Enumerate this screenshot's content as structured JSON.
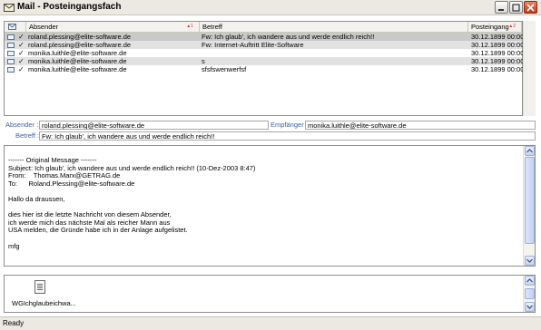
{
  "window": {
    "title": "Mail - Posteingangsfach",
    "accent": "#3b5ea8"
  },
  "list": {
    "columns": {
      "from": "Absender",
      "subject": "Betreff",
      "received": "Posteingang"
    },
    "rows": [
      {
        "from": "roland.plessing@elite-software.de",
        "subject": "Fw: Ich glaub', ich wandere aus und werde endlich reich!!",
        "date": "30.12.1899 00:00",
        "attachment": true,
        "selected": true
      },
      {
        "from": "roland.plessing@elite-software.de",
        "subject": "Fw: Internet-Auftritt Elite-Software",
        "date": "30.12.1899 00:00",
        "attachment": true,
        "selected": false
      },
      {
        "from": "monika.luithle@elite-software.de",
        "subject": "",
        "date": "30.12.1899 00:00",
        "attachment": false,
        "selected": false
      },
      {
        "from": "monika.luithle@elite-software.de",
        "subject": "s",
        "date": "30.12.1899 00:00",
        "attachment": false,
        "selected": false
      },
      {
        "from": "monika.luithle@elite-software.de",
        "subject": "sfsfswenwerfsf",
        "date": "30.12.1899 00:00",
        "attachment": false,
        "selected": false
      }
    ]
  },
  "header": {
    "from_label": "Absender :",
    "from_value": "roland.plessing@elite-software.de",
    "to_label": "Empfänger :",
    "to_value": "monika.luithle@elite-software.de",
    "subject_label": "Betreff :",
    "subject_value": "Fw: Ich glaub', ich wandere aus und werde endlich reich!!"
  },
  "body": {
    "text": "------- Original Message -------\nSubject: Ich glaub', ich wandere aus und werde endlich reich!! (10-Dez-2003 8:47)\nFrom:    Thomas.Marx@GETRAG.de\nTo:      Roland.Plessing@elite-software.de\n\nHallo da draussen,\n\ndies hier ist die letzte Nachricht von diesem Absender,\nich werde mich das nächste Mal als reicher Mann aus\nUSA melden, die Gründe habe ich in der Anlage aufgelistet.\n\nmfg"
  },
  "attachments": [
    {
      "name": "WGIchglaubeichwa..."
    }
  ],
  "status": {
    "text": "Ready"
  }
}
